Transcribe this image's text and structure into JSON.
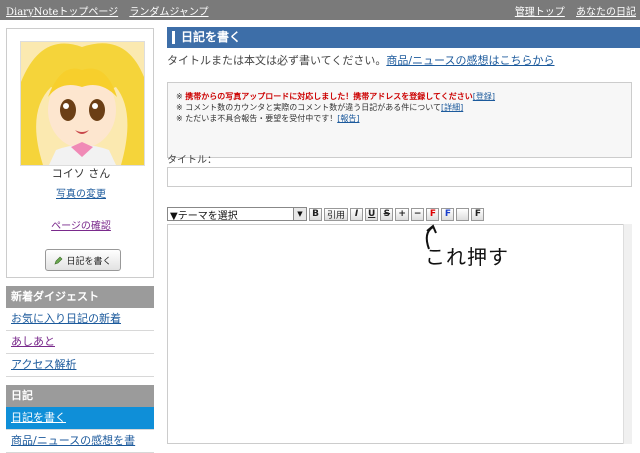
{
  "topbar": {
    "brand": "DiaryNote",
    "links_left": [
      "トップページ",
      "ランダムジャンプ"
    ],
    "links_right": [
      "管理トップ",
      "あなたの日記"
    ]
  },
  "profile": {
    "name": "コイソ さん",
    "change_photo": "写真の変更",
    "confirm_page": "ページの確認",
    "write_button": "日記を書く"
  },
  "sidebar": {
    "digest_header": "新着ダイジェスト",
    "digest_items": [
      "お気に入り日記の新着",
      "あしあと",
      "アクセス解析"
    ],
    "diary_header": "日記",
    "diary_items": [
      "日記を書く",
      "商品/ニュースの感想を書"
    ]
  },
  "main": {
    "title": "日記を書く",
    "required_note": "タイトルまたは本文は必ず書いてください。",
    "impression_link": "商品/ニュースの感想はこちらから",
    "notice_line1_red": "携帯からの写真アップロードに対応しました！携帯アドレスを登録してください",
    "notice_line1_link": "[登録]",
    "notice_line2": "コメント数のカウンタと実際のコメント数が違う日記がある件について",
    "notice_line2_link": "[詳細]",
    "notice_line3": "ただいま不具合報告・要望を受付中です！",
    "notice_line3_link": "[報告]",
    "title_label": "タイトル：",
    "theme_select": "▼テーマを選択",
    "toolbar_buttons": [
      "B",
      "引用",
      "I",
      "U",
      "S",
      "+",
      "−",
      "F",
      "F",
      "",
      "F"
    ],
    "annotation": "これ押す"
  },
  "colors": {
    "accent": "#3d6ea8",
    "active_item": "#0f8fd8",
    "sidebar_header": "#9b9b9b",
    "topbar": "#7a7a7a"
  }
}
